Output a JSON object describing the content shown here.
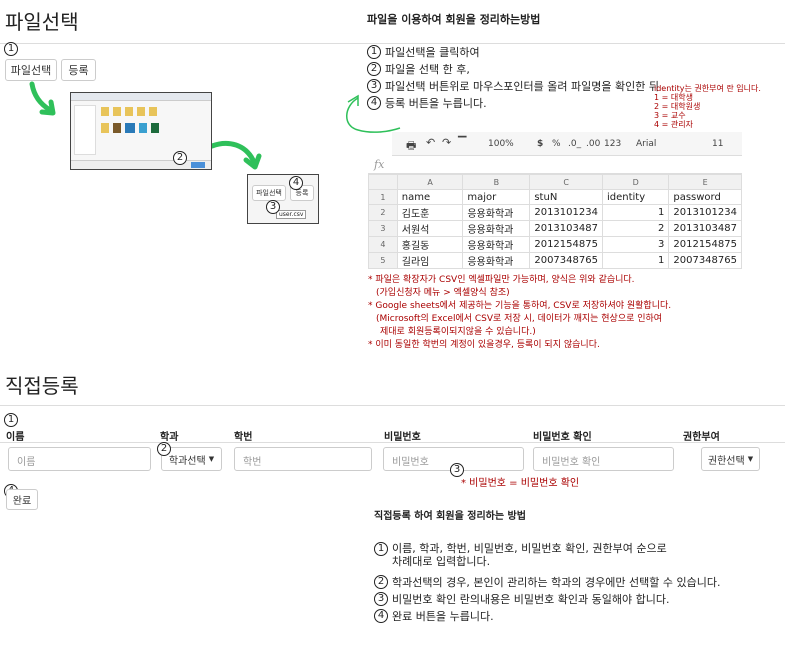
{
  "section1": {
    "title": "파일선택",
    "heading": "파일을 이용하여 회원을 정리하는방법",
    "file_button": "파일선택",
    "register_button": "등록",
    "steps": [
      "파일선택을 클릭하여",
      "파일을 선택 한 후,",
      "파일선택 버튼위로 마우스포인터를 올려 파일명을 확인한 뒤",
      "등록 버튼을 누릅니다."
    ],
    "identity_note": [
      "identity는 권한부여 란 입니다.",
      "1 = 대학생",
      "2 = 대학원생",
      "3 = 교수",
      "4 = 관리자"
    ],
    "mini_file_button": "파일선택",
    "mini_register_button": "등록",
    "mini_tooltip": "user.csv",
    "markers": [
      "1",
      "2",
      "3",
      "4"
    ]
  },
  "sheet": {
    "zoom": "100%",
    "currency": "$",
    "percent": "%",
    "dec1": ".0_",
    "dec2": ".00",
    "format": "123",
    "font": "Arial",
    "size": "11",
    "fx": "fx",
    "col_letters": [
      "A",
      "B",
      "C",
      "D",
      "E"
    ],
    "headers": [
      "name",
      "major",
      "stuN",
      "identity",
      "password"
    ],
    "rows": [
      {
        "n": "1"
      },
      {
        "n": "2",
        "cells": [
          "김도훈",
          "응용화학과",
          "2013101234",
          "1",
          "2013101234"
        ]
      },
      {
        "n": "3",
        "cells": [
          "서원석",
          "응용화학과",
          "2013103487",
          "2",
          "2013103487"
        ]
      },
      {
        "n": "4",
        "cells": [
          "홍길동",
          "응용화학과",
          "2012154875",
          "3",
          "2012154875"
        ]
      },
      {
        "n": "5",
        "cells": [
          "길라임",
          "응용화학과",
          "2007348765",
          "1",
          "2007348765"
        ]
      }
    ]
  },
  "notes": [
    "* 파일은 확장자가 CSV인 엑셀파일만 가능하며, 양식은 위와 같습니다.",
    "  (가입신청자 메뉴 > 엑셀양식 참조)",
    "* Google sheets에서 제공하는 기능을 통하여, CSV로 저장하셔야 원활합니다.",
    "  (Microsoft의 Excel에서 CSV로 저장 시, 데이터가 깨지는 현상으로 인하여",
    "   제대로 회원등록이되지않을 수 있습니다.)",
    "* 이미 동일한 학번의 계정이 있을경우, 등록이 되지 않습니다."
  ],
  "section2": {
    "title": "직접등록",
    "labels": {
      "name": "이름",
      "dept": "학과",
      "stuno": "학번",
      "pw": "비밀번호",
      "pw2": "비밀번호 확인",
      "role": "권한부여"
    },
    "placeholders": {
      "name": "이름",
      "stuno": "학번",
      "pw": "비밀번호",
      "pw2": "비밀번호 확인"
    },
    "dept_select": "학과선택",
    "role_select": "권한선택",
    "done_button": "완료",
    "pw_note": "* 비밀번호 = 비밀번호 확인",
    "heading": "직접등록 하여 회원을 정리하는 방법",
    "steps": [
      [
        "이름, 학과, 학번, 비밀번호, 비밀번호 확인, 권한부여 순으로",
        "차례대로 입력합니다."
      ],
      [
        "학과선택의 경우, 본인이 관리하는 학과의 경우에만 선택할 수 있습니다."
      ],
      [
        "비밀번호 확인 란의내용은 비밀번호 확인과 동일해야 합니다."
      ],
      [
        "완료 버튼을 누릅니다."
      ]
    ],
    "markers": [
      "1",
      "2",
      "3",
      "4"
    ]
  },
  "colors": {
    "accent_green": "#2fc05a",
    "note_red": "#a00000"
  }
}
